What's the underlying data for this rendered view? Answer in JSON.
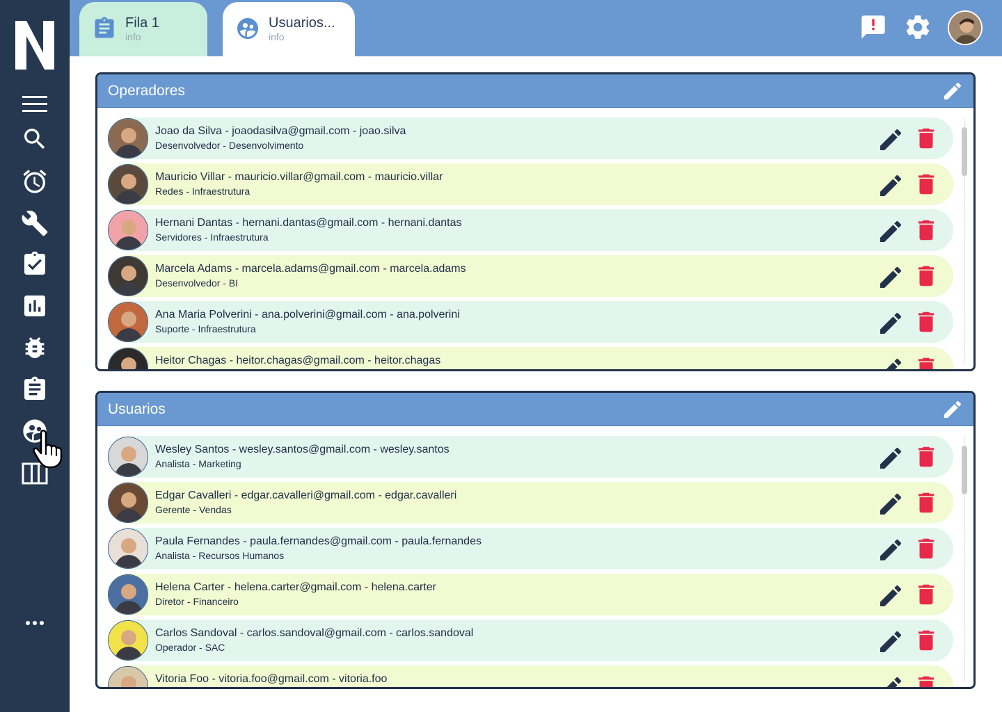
{
  "app": {
    "logo_letter": "N"
  },
  "sidebar": {
    "items": [
      {
        "icon": "menu-icon"
      },
      {
        "icon": "search-icon"
      },
      {
        "icon": "alarm-icon"
      },
      {
        "icon": "wrench-icon"
      },
      {
        "icon": "clipboard-check-icon"
      },
      {
        "icon": "chart-icon"
      },
      {
        "icon": "bug-icon"
      },
      {
        "icon": "clipboard-list-icon"
      },
      {
        "icon": "users-icon"
      },
      {
        "icon": "columns-icon"
      },
      {
        "icon": "more-icon"
      }
    ]
  },
  "tabs": [
    {
      "title": "Fila 1",
      "subtitle": "info",
      "icon": "clipboard-list-icon"
    },
    {
      "title": "Usuarios...",
      "subtitle": "info",
      "icon": "users-icon"
    }
  ],
  "top_icons": [
    "alert-icon",
    "gear-icon",
    "profile-avatar"
  ],
  "colors": {
    "sidebar": "#263850",
    "topbar": "#6a98d0",
    "row_green": "#e2f6ee",
    "row_yellow": "#f1fad0",
    "delete": "#e8294a",
    "edit": "#23324a"
  },
  "operadores": {
    "title": "Operadores",
    "rows": [
      {
        "main": "Joao da Silva - joaodasilva@gmail.com - joao.silva",
        "sub": "Desenvolvedor - Desenvolvimento",
        "avatar": "#8a6a50"
      },
      {
        "main": "Mauricio Villar - mauricio.villar@gmail.com - mauricio.villar",
        "sub": "Redes - Infraestrutura",
        "avatar": "#5a4a3e"
      },
      {
        "main": "Hernani Dantas - hernani.dantas@gmail.com - hernani.dantas",
        "sub": "Servidores - Infraestrutura",
        "avatar": "#f2a3a8"
      },
      {
        "main": "Marcela Adams - marcela.adams@gmail.com - marcela.adams",
        "sub": "Desenvolvedor - BI",
        "avatar": "#3e3a33"
      },
      {
        "main": "Ana Maria Polverini - ana.polverini@gmail.com - ana.polverini",
        "sub": "Suporte - Infraestrutura",
        "avatar": "#c2683e"
      },
      {
        "main": "Heitor Chagas - heitor.chagas@gmail.com - heitor.chagas",
        "sub": "",
        "avatar": "#2a2a2a"
      }
    ]
  },
  "usuarios": {
    "title": "Usuarios",
    "rows": [
      {
        "main": "Wesley Santos - wesley.santos@gmail.com - wesley.santos",
        "sub": "Analista - Marketing",
        "avatar": "#d8d8d8"
      },
      {
        "main": "Edgar Cavalleri - edgar.cavalleri@gmail.com - edgar.cavalleri",
        "sub": "Gerente - Vendas",
        "avatar": "#6b4a35"
      },
      {
        "main": "Paula Fernandes - paula.fernandes@gmail.com - paula.fernandes",
        "sub": "Analista - Recursos Humanos",
        "avatar": "#e8dfd6"
      },
      {
        "main": "Helena Carter - helena.carter@gmail.com - helena.carter",
        "sub": "Diretor - Financeiro",
        "avatar": "#4a6fa0"
      },
      {
        "main": "Carlos Sandoval - carlos.sandoval@gmail.com - carlos.sandoval",
        "sub": "Operador - SAC",
        "avatar": "#f2e24a"
      },
      {
        "main": "Vitoria Foo - vitoria.foo@gmail.com - vitoria.foo",
        "sub": "",
        "avatar": "#d9c8a8"
      }
    ]
  }
}
